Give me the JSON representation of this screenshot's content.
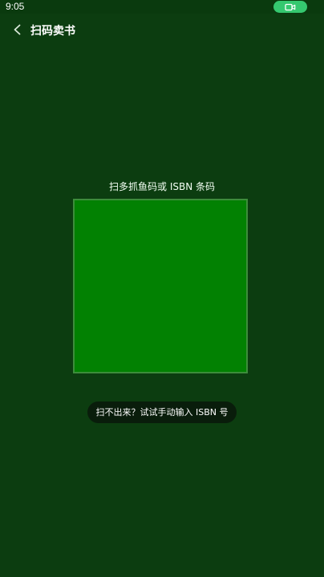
{
  "status_bar": {
    "time": "9:05",
    "video_icon": "video-camera-icon",
    "pill_color": "#35c86f"
  },
  "nav": {
    "back_icon": "chevron-left-icon",
    "title": "扫码卖书"
  },
  "scanner": {
    "prompt": "扫多抓鱼码或 ISBN 条码",
    "frame_color": "#028102",
    "background_color": "#0c3d10"
  },
  "manual_entry": {
    "label": "扫不出来？试试手动输入 ISBN 号"
  }
}
